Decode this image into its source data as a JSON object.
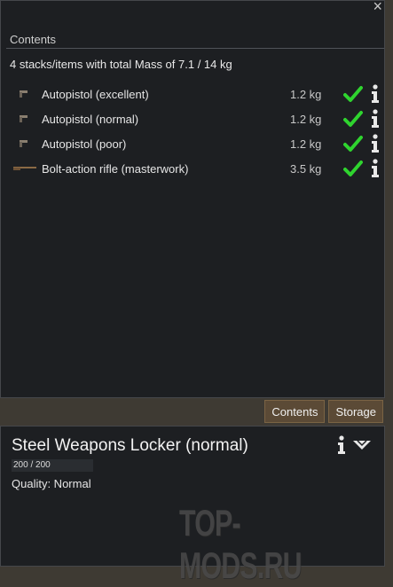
{
  "window": {
    "close_label": "×"
  },
  "contents": {
    "header": "Contents",
    "summary": "4 stacks/items with total Mass of 7.1 / 14 kg",
    "items": [
      {
        "label": "Autopistol (excellent)",
        "mass": "1.2 kg",
        "icon": "autopistol-icon"
      },
      {
        "label": "Autopistol (normal)",
        "mass": "1.2 kg",
        "icon": "autopistol-icon"
      },
      {
        "label": "Autopistol (poor)",
        "mass": "1.2 kg",
        "icon": "autopistol-icon"
      },
      {
        "label": "Bolt-action rifle (masterwork)",
        "mass": "3.5 kg",
        "icon": "rifle-icon"
      }
    ]
  },
  "tabs": [
    {
      "label": "Contents"
    },
    {
      "label": "Storage"
    }
  ],
  "inspect": {
    "title": "Steel Weapons Locker (normal)",
    "hit_points": "200 / 200",
    "hit_points_fraction": 1.0,
    "quality": "Quality: Normal"
  },
  "watermark": "TOP-MODS.RU",
  "colors": {
    "check": "#2fd42f",
    "panel_bg": "#1d1f22",
    "tab_bg": "#5b4a36"
  }
}
